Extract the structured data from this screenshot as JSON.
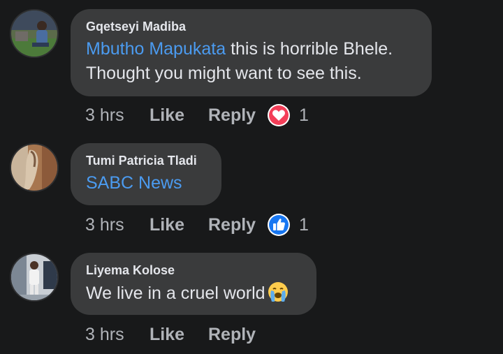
{
  "comments": [
    {
      "author": "Gqetseyi Madiba",
      "mention": "Mbutho Mapukata",
      "text": " this is horrible Bhele.",
      "text2": "Thought you might want to see this.",
      "time": "3 hrs",
      "like_label": "Like",
      "reply_label": "Reply",
      "reaction": "love-icon",
      "reaction_count": "1"
    },
    {
      "author": "Tumi Patricia Tladi",
      "mention": "SABC News",
      "time": "3 hrs",
      "like_label": "Like",
      "reply_label": "Reply",
      "reaction": "like-icon",
      "reaction_count": "1"
    },
    {
      "author": "Liyema Kolose",
      "text": "We live in a cruel world",
      "emoji": "crying-face-icon",
      "time": "3 hrs",
      "like_label": "Like",
      "reply_label": "Reply"
    }
  ],
  "colors": {
    "background": "#18191a",
    "bubble": "#3a3b3c",
    "mention": "#4b9bf0",
    "meta": "#b0b3b8",
    "love": "#f33e58",
    "like": "#1877f2"
  }
}
